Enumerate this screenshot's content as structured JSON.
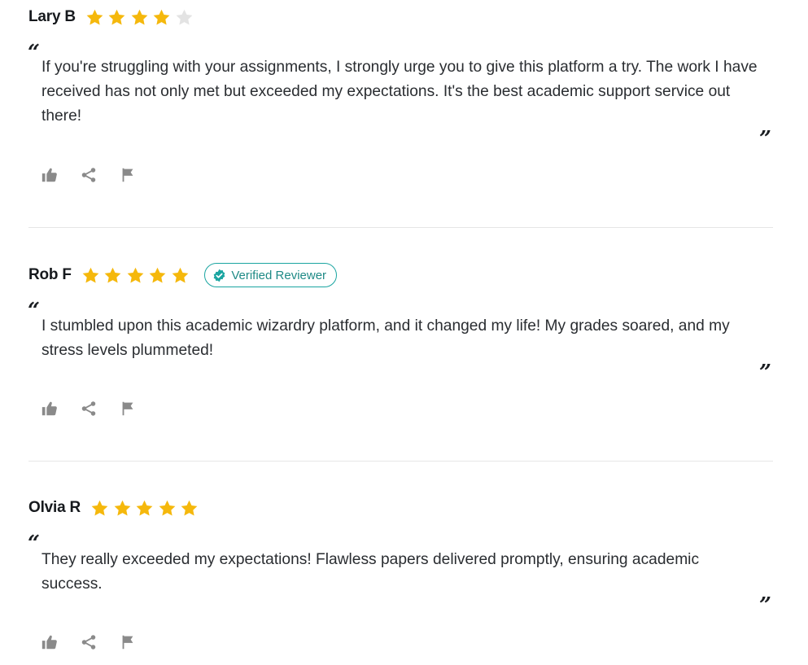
{
  "colors": {
    "star_filled": "#f5b80c",
    "star_empty": "#e3e3e3",
    "verified": "#1aa5a1",
    "action_icon": "#8a8a8a"
  },
  "quote_marks": {
    "open": "“",
    "close": "”"
  },
  "reviews": [
    {
      "name": "Lary B",
      "rating": 4,
      "rating_max": 5,
      "verified": false,
      "text": "If you're struggling with your assignments, I strongly urge you to give this platform a try. The work I have received has not only met but exceeded my expectations. It's the best academic support service out there!",
      "actions": [
        "thumbs-up-icon",
        "share-icon",
        "flag-icon"
      ]
    },
    {
      "name": "Rob F",
      "rating": 5,
      "rating_max": 5,
      "verified": true,
      "verified_label": "Verified Reviewer",
      "text": "I stumbled upon this academic wizardry platform, and it changed my life! My grades soared, and my stress levels plummeted!",
      "actions": [
        "thumbs-up-icon",
        "share-icon",
        "flag-icon"
      ]
    },
    {
      "name": "Olvia R",
      "rating": 5,
      "rating_max": 5,
      "verified": false,
      "text": "They really exceeded my expectations! Flawless papers delivered promptly, ensuring academic success.",
      "actions": [
        "thumbs-up-icon",
        "share-icon",
        "flag-icon"
      ]
    }
  ]
}
